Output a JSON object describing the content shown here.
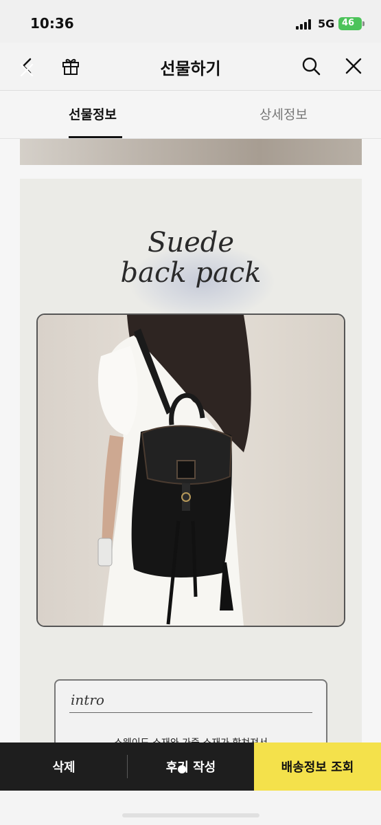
{
  "status_bar": {
    "time": "10:36",
    "network": "5G",
    "battery": "46"
  },
  "header": {
    "title": "선물하기",
    "icons": {
      "back": "back-icon",
      "gift": "gift-icon",
      "search": "search-icon",
      "close": "close-icon"
    }
  },
  "tabs": [
    {
      "label": "선물정보",
      "active": true
    },
    {
      "label": "상세정보",
      "active": false
    }
  ],
  "product": {
    "title_line1": "Suede",
    "title_line2": "back pack",
    "photo_alt": "backpack photo",
    "intro_label": "intro",
    "intro_text": "스웨이드 소재와 가죽 소재가 합쳐져서"
  },
  "bottom_bar": {
    "delete": "삭제",
    "review": "후기 작성",
    "shipping": "배송정보 조회"
  },
  "colors": {
    "accent_yellow": "#f4e14b",
    "bar_dark": "#1e1e1e",
    "battery_green": "#4cc35a"
  }
}
